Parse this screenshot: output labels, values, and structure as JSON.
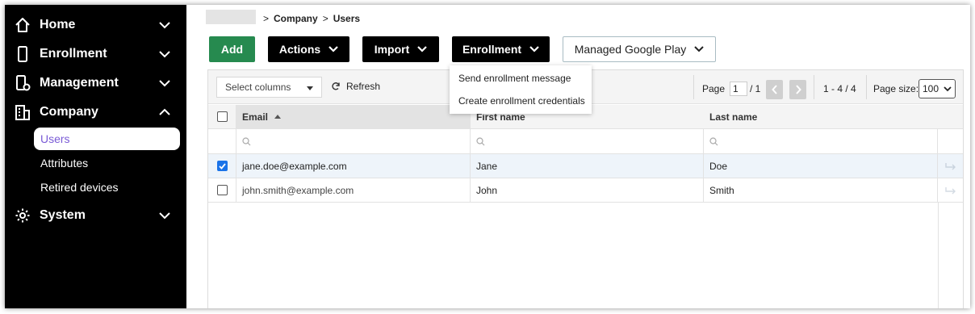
{
  "sidebar": {
    "items": [
      {
        "label": "Home",
        "icon": "home-icon",
        "expanded": false
      },
      {
        "label": "Enrollment",
        "icon": "phone-icon",
        "expanded": false
      },
      {
        "label": "Management",
        "icon": "device-gear-icon",
        "expanded": false
      },
      {
        "label": "Company",
        "icon": "building-icon",
        "expanded": true
      },
      {
        "label": "System",
        "icon": "gear-icon",
        "expanded": false
      }
    ],
    "company_sub": [
      {
        "label": "Users",
        "active": true
      },
      {
        "label": "Attributes",
        "active": false
      },
      {
        "label": "Retired devices",
        "active": false
      }
    ]
  },
  "breadcrumb": {
    "sep": ">",
    "company": "Company",
    "users": "Users"
  },
  "toolbar": {
    "add": "Add",
    "actions": "Actions",
    "import": "Import",
    "enrollment": "Enrollment",
    "managed_google_play": "Managed Google Play"
  },
  "enrollment_menu": {
    "items": [
      "Send enrollment message",
      "Create enrollment credentials"
    ]
  },
  "grid_toolbar": {
    "select_columns": "Select columns",
    "refresh": "Refresh",
    "page_label": "Page",
    "page_value": "1",
    "page_total": "/ 1",
    "range": "1 - 4 / 4",
    "page_size_label": "Page size:",
    "page_size_value": "100"
  },
  "table": {
    "columns": [
      "Email",
      "First name",
      "Last name"
    ],
    "sort": {
      "column": "Email",
      "direction": "asc"
    },
    "rows": [
      {
        "email": "jane.doe@example.com",
        "first": "Jane",
        "last": "Doe",
        "selected": true
      },
      {
        "email": "john.smith@example.com",
        "first": "John",
        "last": "Smith",
        "selected": false
      }
    ]
  },
  "colors": {
    "sidebar_bg": "#000000",
    "add_button": "#268a4f",
    "active_sub_text": "#7a5bd6",
    "checkbox_checked": "#1a73e8",
    "selected_row": "#eef4fa"
  }
}
